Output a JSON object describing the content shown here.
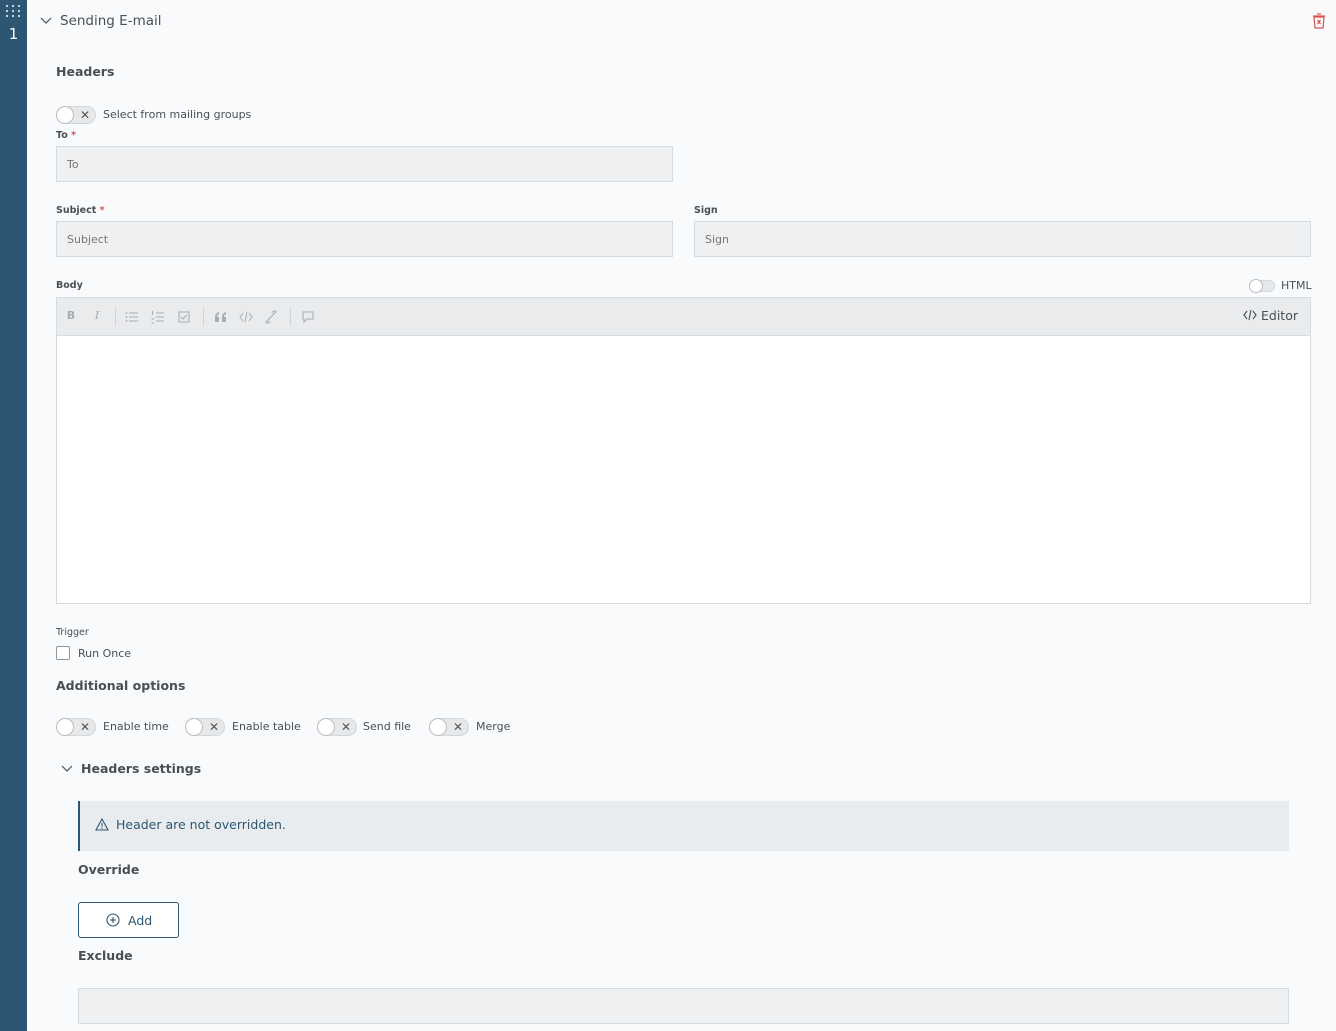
{
  "rail": {
    "number": "1"
  },
  "section": {
    "title": "Sending E-mail"
  },
  "headers": {
    "title": "Headers",
    "mailing_toggle_label": "Select from mailing groups",
    "to_label": "To",
    "to_placeholder": "To",
    "subject_label": "Subject",
    "subject_placeholder": "Subject",
    "sign_label": "Sign",
    "sign_placeholder": "Sign",
    "required_mark": "*"
  },
  "body": {
    "label": "Body",
    "html_toggle_label": "HTML",
    "editor_button": "Editor",
    "toolbar": {
      "bold": "B",
      "italic": "I"
    }
  },
  "trigger": {
    "label": "Trigger",
    "run_once_label": "Run Once"
  },
  "additional": {
    "title": "Additional options",
    "toggles": [
      "Enable time",
      "Enable table",
      "Send file",
      "Merge"
    ]
  },
  "headers_settings": {
    "title": "Headers settings",
    "notice": "Header are not overridden.",
    "override_title": "Override",
    "add_button": "Add",
    "exclude_title": "Exclude"
  },
  "colors": {
    "rail": "#2d5672",
    "accent": "#2d5672",
    "required": "#d9534f",
    "trash": "#d9534f"
  }
}
